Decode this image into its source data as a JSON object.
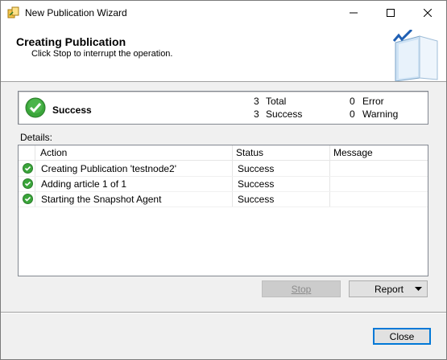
{
  "window": {
    "title": "New Publication Wizard",
    "controls": {
      "minimize": "minimize",
      "maximize": "maximize",
      "close": "close"
    }
  },
  "header": {
    "title": "Creating Publication",
    "subtitle": "Click Stop to interrupt the operation."
  },
  "summary": {
    "status": "Success",
    "total_count": "3",
    "total_label": "Total",
    "success_count": "3",
    "success_label": "Success",
    "error_count": "0",
    "error_label": "Error",
    "warning_count": "0",
    "warning_label": "Warning"
  },
  "details": {
    "label": "Details:",
    "columns": [
      "Action",
      "Status",
      "Message"
    ],
    "rows": [
      {
        "action": "Creating Publication 'testnode2'",
        "status": "Success",
        "message": ""
      },
      {
        "action": "Adding article 1 of 1",
        "status": "Success",
        "message": ""
      },
      {
        "action": "Starting the Snapshot Agent",
        "status": "Success",
        "message": ""
      }
    ]
  },
  "buttons": {
    "stop": "Stop",
    "report": "Report",
    "close": "Close"
  },
  "colors": {
    "success_green": "#3aa53a",
    "accent": "#0078d7"
  }
}
